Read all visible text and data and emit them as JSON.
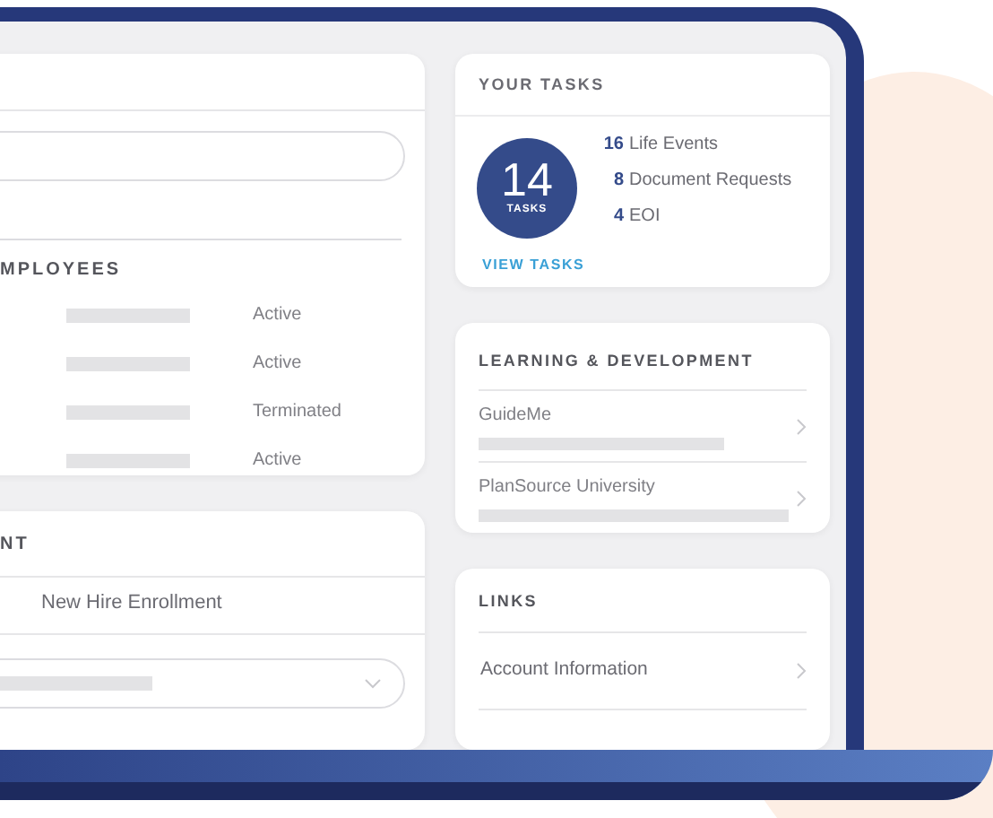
{
  "employees_card": {
    "heading": "MPLOYEES",
    "rows": [
      {
        "status": "Active"
      },
      {
        "status": "Active"
      },
      {
        "status": "Terminated"
      },
      {
        "status": "Active"
      }
    ]
  },
  "enrollment_card": {
    "heading": "NT",
    "item": "New Hire Enrollment"
  },
  "tasks": {
    "title": "YOUR TASKS",
    "count": "14",
    "count_label": "TASKS",
    "items": [
      {
        "count": "16",
        "label": "Life Events"
      },
      {
        "count": "8",
        "label": "Document Requests"
      },
      {
        "count": "4",
        "label": "EOI"
      }
    ],
    "link": "VIEW TASKS"
  },
  "learning": {
    "title": "LEARNING & DEVELOPMENT",
    "items": [
      {
        "label": "GuideMe"
      },
      {
        "label": "PlanSource University"
      }
    ]
  },
  "links": {
    "title": "LINKS",
    "items": [
      {
        "label": "Account Information"
      }
    ]
  }
}
